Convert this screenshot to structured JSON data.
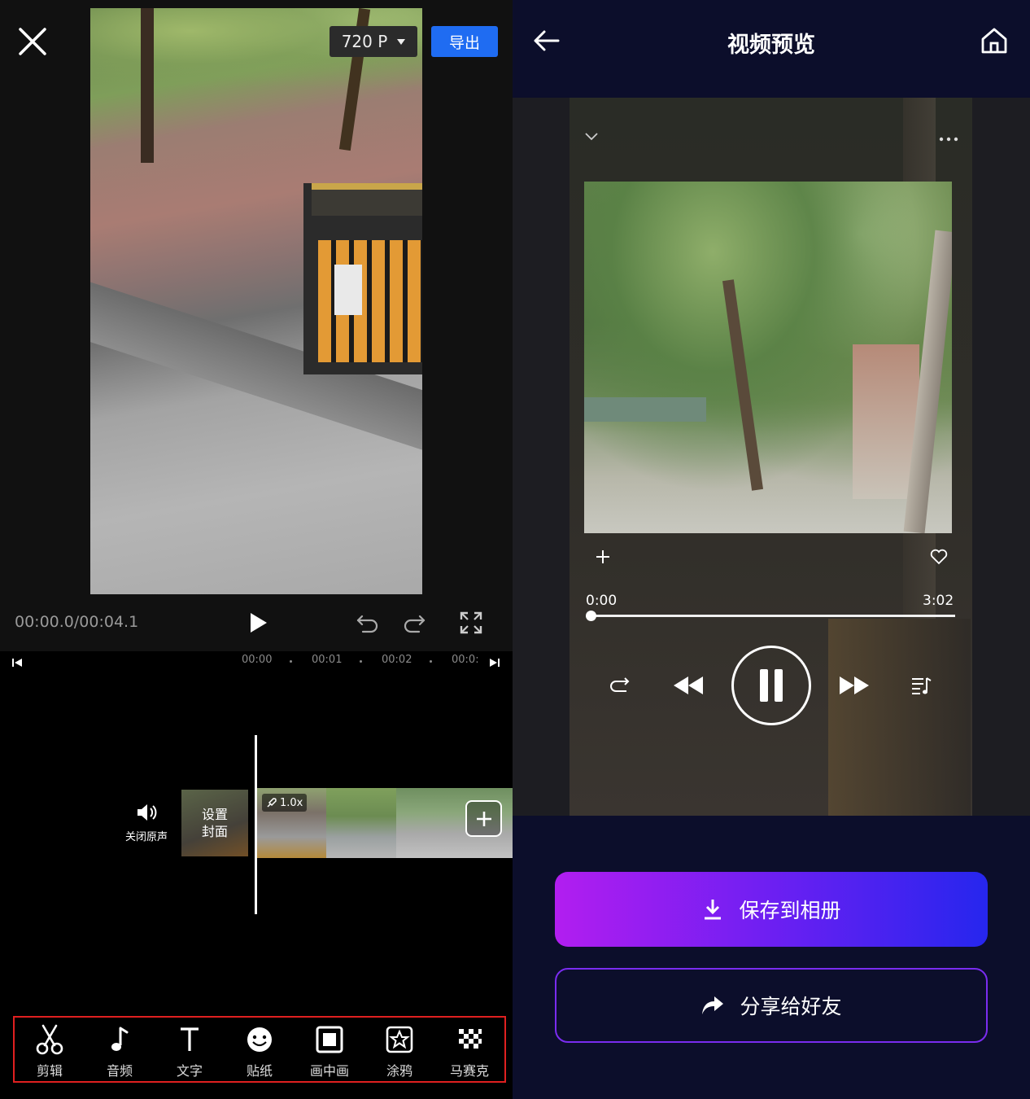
{
  "editor": {
    "resolution_label": "720 P",
    "export_label": "导出",
    "timecode": "00:00.0/00:04.1",
    "ruler_ticks": [
      "00:00",
      "00:01",
      "00:02",
      "00:0:"
    ],
    "mute_label": "关闭原声",
    "cover_label": "设置\n封面",
    "speed_label": "1.0x",
    "tools": [
      {
        "label": "剪辑",
        "icon": "scissors-icon"
      },
      {
        "label": "音频",
        "icon": "music-note-icon"
      },
      {
        "label": "文字",
        "icon": "text-icon"
      },
      {
        "label": "贴纸",
        "icon": "sticker-icon"
      },
      {
        "label": "画中画",
        "icon": "picture-in-picture-icon"
      },
      {
        "label": "涂鸦",
        "icon": "doodle-icon"
      },
      {
        "label": "马赛克",
        "icon": "mosaic-icon"
      }
    ]
  },
  "preview": {
    "title": "视频预览",
    "time_current": "0:00",
    "time_total": "3:02",
    "progress_fraction": 0,
    "save_label": "保存到相册",
    "share_label": "分享给好友"
  },
  "colors": {
    "export_blue": "#1f6cf2",
    "toolbar_outline": "#e02020",
    "preview_bg": "#0c0e2b",
    "save_gradient_start": "#b21ef0",
    "save_gradient_end": "#2626ee"
  }
}
